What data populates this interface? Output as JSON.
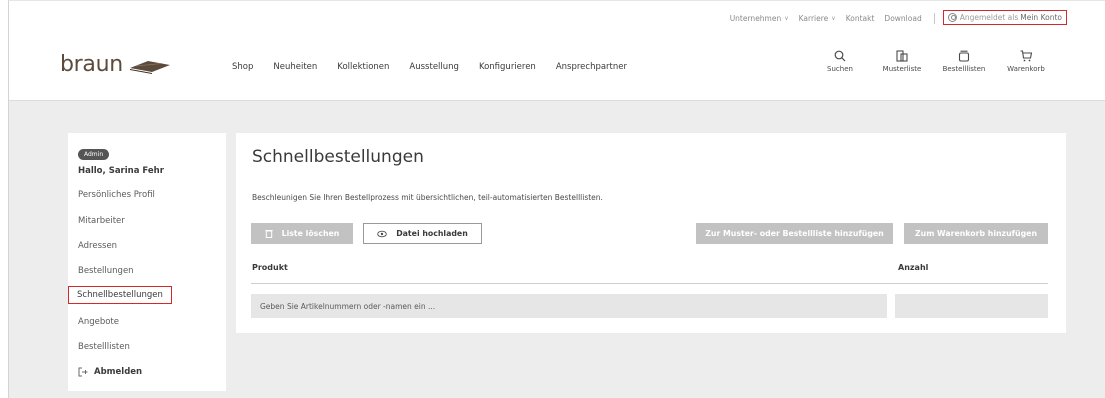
{
  "util_nav": {
    "items": [
      {
        "label": "Unternehmen",
        "has_dropdown": true
      },
      {
        "label": "Karriere",
        "has_dropdown": true
      },
      {
        "label": "Kontakt",
        "has_dropdown": false
      },
      {
        "label": "Download",
        "has_dropdown": false
      }
    ],
    "account_prefix": "Angemeldet als",
    "account_label": "Mein Konto"
  },
  "logo": {
    "text": "braun"
  },
  "main_nav": [
    "Shop",
    "Neuheiten",
    "Kollektionen",
    "Ausstellung",
    "Konfigurieren",
    "Ansprechpartner"
  ],
  "header_icons": [
    {
      "name": "search-icon",
      "label": "Suchen"
    },
    {
      "name": "sample-list-icon",
      "label": "Musterliste"
    },
    {
      "name": "order-list-icon",
      "label": "Bestelllisten"
    },
    {
      "name": "cart-icon",
      "label": "Warenkorb"
    }
  ],
  "sidebar": {
    "badge": "Admin",
    "greeting": "Hallo, Sarina Fehr",
    "items": [
      {
        "label": "Persönliches Profil",
        "active": false
      },
      {
        "label": "Mitarbeiter",
        "active": false
      },
      {
        "label": "Adressen",
        "active": false
      },
      {
        "label": "Bestellungen",
        "active": false
      },
      {
        "label": "Schnellbestellungen",
        "active": true
      },
      {
        "label": "Angebote",
        "active": false
      },
      {
        "label": "Bestelllisten",
        "active": false
      }
    ],
    "logout": "Abmelden"
  },
  "main": {
    "title": "Schnellbestellungen",
    "subtitle": "Beschleunigen Sie Ihren Bestellprozess mit übersichtlichen, teil-automatisierten Bestelllisten.",
    "buttons": {
      "clear": "Liste löschen",
      "upload": "Datei hochladen",
      "add_to_list": "Zur Muster- oder Bestellliste hinzufügen",
      "add_to_cart": "Zum Warenkorb hinzufügen"
    },
    "columns": {
      "product": "Produkt",
      "quantity": "Anzahl"
    },
    "input_placeholder": "Geben Sie Artikelnummern oder -namen ein ..."
  },
  "colors": {
    "highlight": "#d22a2a",
    "brand_brown": "#5c4a3a",
    "button_gray": "#c2c2c2",
    "band_gray": "#ededed"
  }
}
